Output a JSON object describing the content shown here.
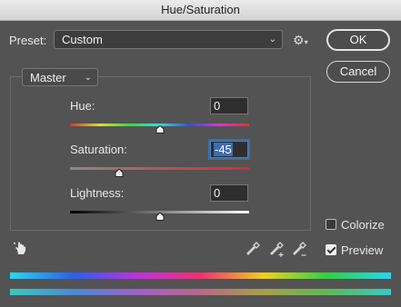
{
  "window": {
    "title": "Hue/Saturation"
  },
  "preset": {
    "label": "Preset:",
    "value": "Custom"
  },
  "buttons": {
    "ok": "OK",
    "cancel": "Cancel"
  },
  "channel": {
    "value": "Master"
  },
  "sliders": [
    {
      "label": "Hue:",
      "value": "0",
      "level": 0.5
    },
    {
      "label": "Saturation:",
      "value": "-45",
      "level": 0.275
    },
    {
      "label": "Lightness:",
      "value": "0",
      "level": 0.5
    }
  ],
  "options": {
    "colorize": {
      "label": "Colorize",
      "checked": false
    },
    "preview": {
      "label": "Preview",
      "checked": true
    }
  },
  "icons": {
    "settings": "gear-icon",
    "targeted_adjustment": "hand-adjust-icon",
    "eyedropper": "eyedropper-icon",
    "eyedropper_add": "eyedropper-add-icon",
    "eyedropper_subtract": "eyedropper-subtract-icon"
  }
}
